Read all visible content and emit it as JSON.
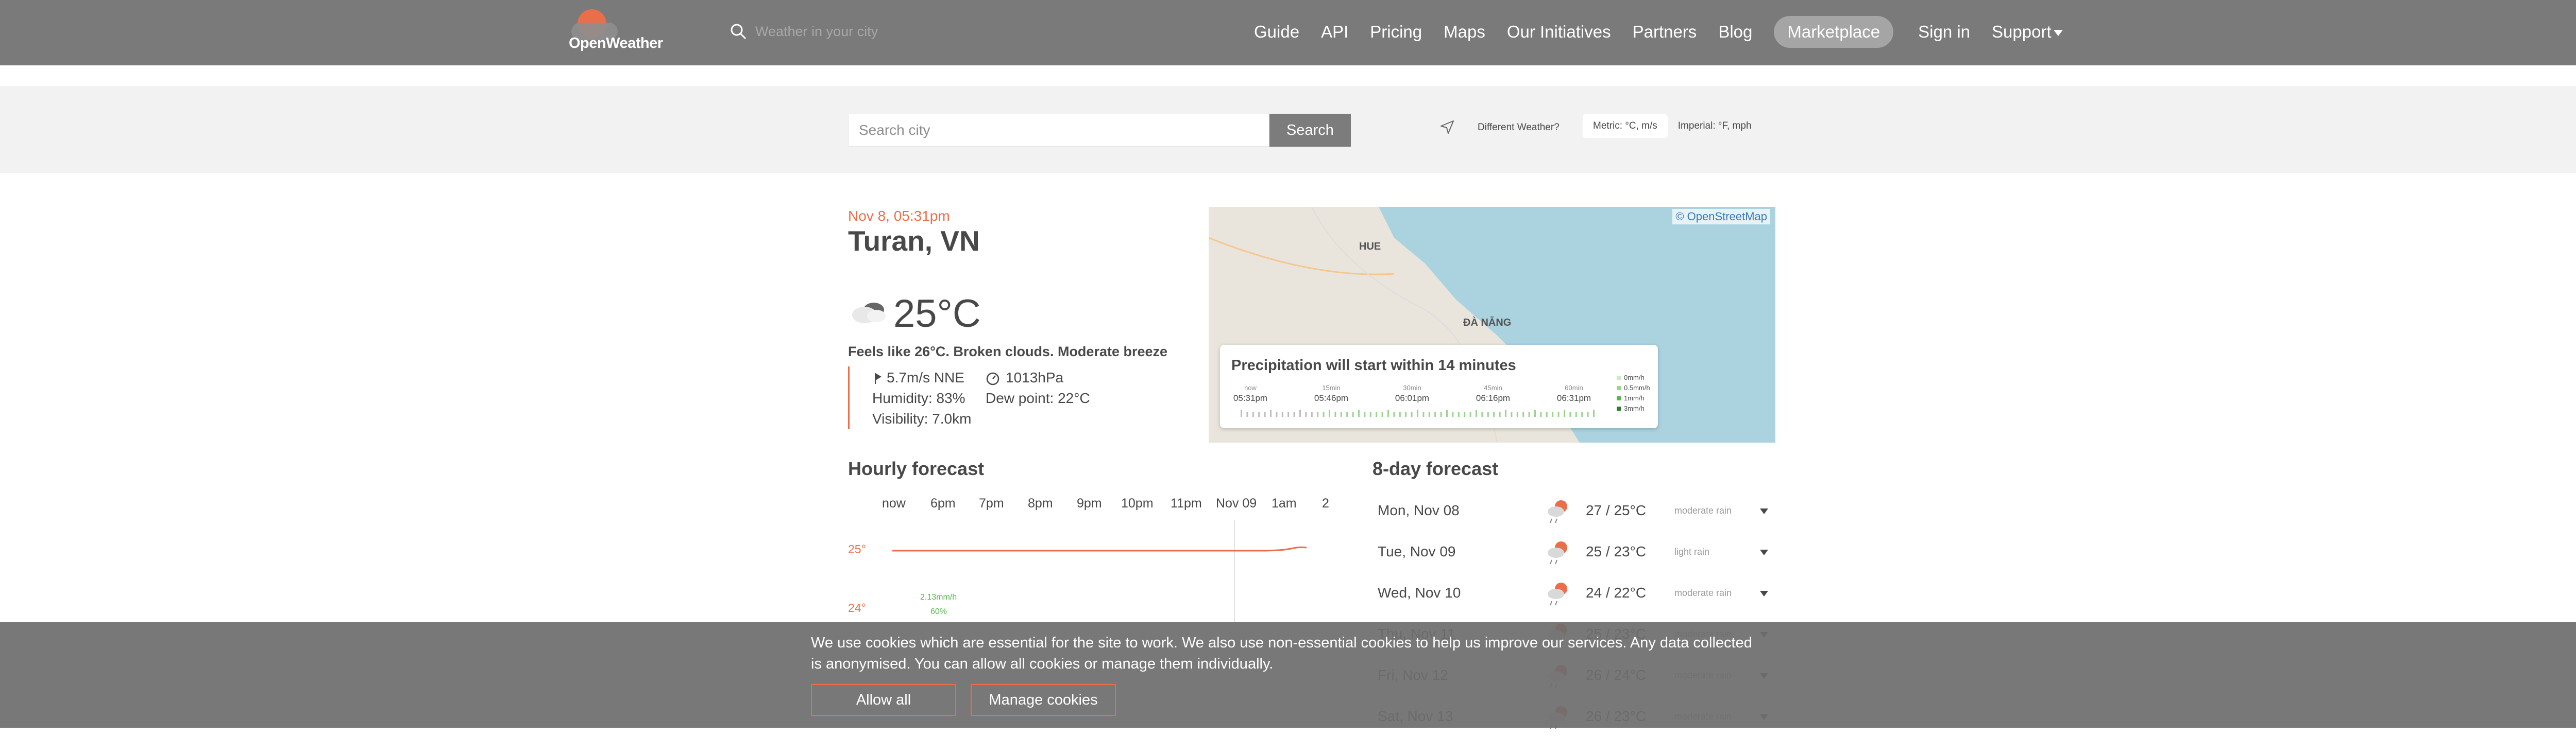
{
  "header": {
    "logo_text": "OpenWeather",
    "search_placeholder": "Weather in your city",
    "nav": [
      "Guide",
      "API",
      "Pricing",
      "Maps",
      "Our Initiatives",
      "Partners",
      "Blog",
      "Marketplace",
      "Sign in",
      "Support"
    ]
  },
  "search": {
    "placeholder": "Search city",
    "button": "Search",
    "different_weather": "Different Weather?",
    "unit_metric": "Metric: °C, m/s",
    "unit_imperial": "Imperial: °F, mph"
  },
  "current": {
    "datetime": "Nov 8, 05:31pm",
    "city": "Turan, VN",
    "temp": "25°C",
    "feels": "Feels like 26°C. Broken clouds. Moderate breeze",
    "wind": "5.7m/s NNE",
    "pressure": "1013hPa",
    "humidity": "Humidity: 83%",
    "dew": "Dew point: 22°C",
    "visibility": "Visibility: 7.0km"
  },
  "map": {
    "attribution": "© OpenStreetMap",
    "labels": [
      "HUE",
      "ĐÀ NẴNG"
    ],
    "precip_title": "Precipitation will start within 14 minutes",
    "ticks": [
      "now",
      "15min",
      "30min",
      "45min",
      "60min"
    ],
    "times": [
      "05:31pm",
      "05:46pm",
      "06:01pm",
      "06:16pm",
      "06:31pm"
    ],
    "legend": [
      "0mm/h",
      "0.5mm/h",
      "1mm/h",
      "3mm/h"
    ]
  },
  "hourly": {
    "title": "Hourly forecast",
    "hours": [
      "now",
      "6pm",
      "7pm",
      "8pm",
      "9pm",
      "10pm",
      "11pm",
      "Nov 09",
      "1am",
      "2"
    ],
    "y_labels": [
      "25°",
      "24°"
    ],
    "precip_label": "2.13mm/h",
    "prob_label": "60%"
  },
  "daily": {
    "title": "8-day forecast",
    "rows": [
      {
        "day": "Mon, Nov 08",
        "temp": "27 / 25°C",
        "desc": "moderate rain"
      },
      {
        "day": "Tue, Nov 09",
        "temp": "25 / 23°C",
        "desc": "light rain"
      },
      {
        "day": "Wed, Nov 10",
        "temp": "24 / 22°C",
        "desc": "moderate rain"
      },
      {
        "day": "Thu, Nov 11",
        "temp": "25 / 23°C",
        "desc": "moderate rain"
      },
      {
        "day": "Fri, Nov 12",
        "temp": "26 / 24°C",
        "desc": "moderate rain"
      },
      {
        "day": "Sat, Nov 13",
        "temp": "26 / 23°C",
        "desc": "moderate rain"
      }
    ]
  },
  "cookie": {
    "message": "We use cookies which are essential for the site to work. We also use non-essential cookies to help us improve our services. Any data collected is anonymised. You can allow all cookies or manage them individually.",
    "allow": "Allow all",
    "manage": "Manage cookies"
  },
  "colors": {
    "accent": "#eb6e4b",
    "nav_bg": "#7a7a7a",
    "text": "#48484a"
  }
}
